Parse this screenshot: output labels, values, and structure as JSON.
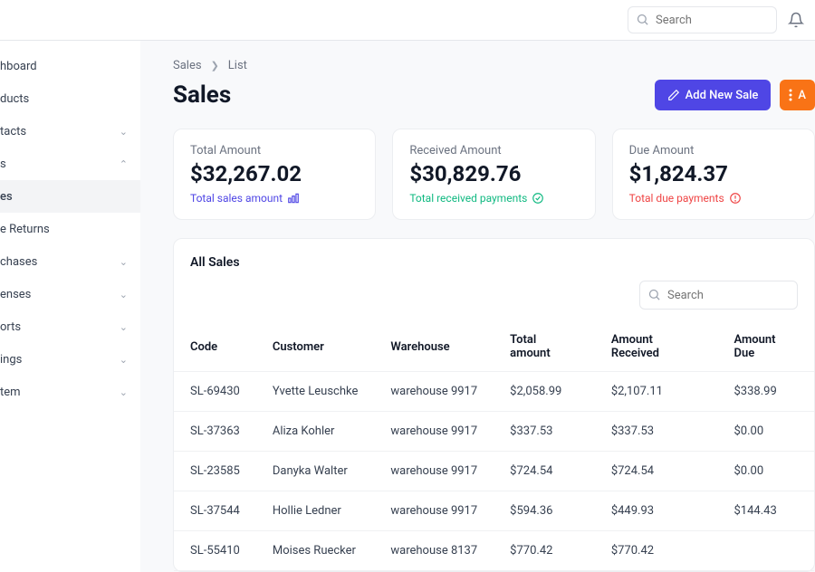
{
  "topbar": {
    "search_placeholder": "Search"
  },
  "sidebar": {
    "items": [
      {
        "label": "hboard",
        "expandable": false
      },
      {
        "label": "ducts",
        "expandable": false
      },
      {
        "label": "tacts",
        "expandable": true,
        "open": false
      },
      {
        "label": "s",
        "expandable": true,
        "open": true
      },
      {
        "label": "es",
        "expandable": false,
        "active": true
      },
      {
        "label": "e Returns",
        "expandable": false
      },
      {
        "label": "chases",
        "expandable": true,
        "open": false
      },
      {
        "label": "enses",
        "expandable": true,
        "open": false
      },
      {
        "label": "orts",
        "expandable": true,
        "open": false
      },
      {
        "label": "ings",
        "expandable": true,
        "open": false
      },
      {
        "label": "tem",
        "expandable": true,
        "open": false
      }
    ]
  },
  "breadcrumb": {
    "a": "Sales",
    "b": "List"
  },
  "page_title": "Sales",
  "actions": {
    "add_label": "Add New Sale",
    "more_label": "A"
  },
  "cards": [
    {
      "label": "Total Amount",
      "amount": "$32,267.02",
      "sub": "Total sales amount",
      "sub_class": "sub-blue",
      "icon": "chart"
    },
    {
      "label": "Received Amount",
      "amount": "$30,829.76",
      "sub": "Total received payments",
      "sub_class": "sub-green",
      "icon": "check"
    },
    {
      "label": "Due Amount",
      "amount": "$1,824.37",
      "sub": "Total due payments",
      "sub_class": "sub-red",
      "icon": "alert"
    }
  ],
  "panel": {
    "title": "All Sales",
    "search_placeholder": "Search",
    "columns": [
      "Code",
      "Customer",
      "Warehouse",
      "Total amount",
      "Amount Received",
      "Amount Due"
    ],
    "rows": [
      [
        "SL-69430",
        "Yvette Leuschke",
        "warehouse 9917",
        "$2,058.99",
        "$2,107.11",
        "$338.99"
      ],
      [
        "SL-37363",
        "Aliza Kohler",
        "warehouse 9917",
        "$337.53",
        "$337.53",
        "$0.00"
      ],
      [
        "SL-23585",
        "Danyka Walter",
        "warehouse 9917",
        "$724.54",
        "$724.54",
        "$0.00"
      ],
      [
        "SL-37544",
        "Hollie Ledner",
        "warehouse 9917",
        "$594.36",
        "$449.93",
        "$144.43"
      ],
      [
        "SL-55410",
        "Moises Ruecker",
        "warehouse 8137",
        "$770.42",
        "$770.42",
        ""
      ]
    ]
  }
}
